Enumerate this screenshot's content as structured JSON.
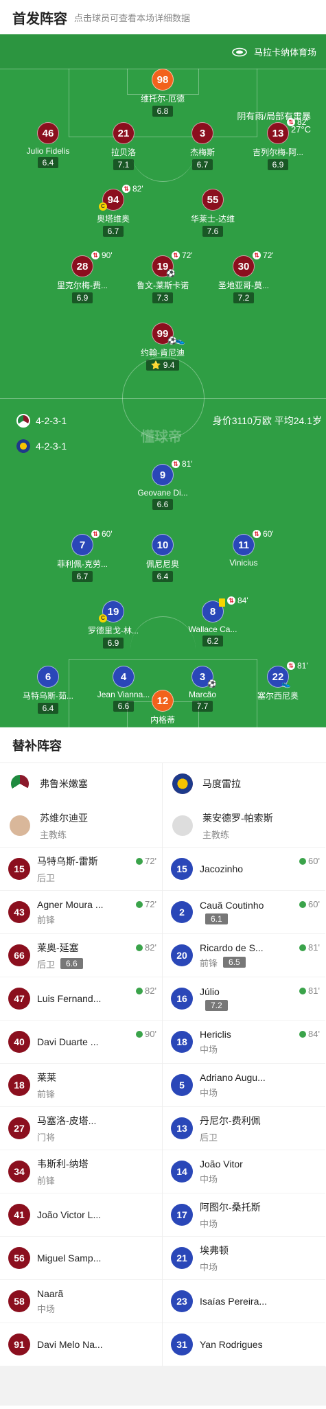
{
  "header": {
    "title": "首发阵容",
    "subtitle": "点击球员可查看本场详细数据"
  },
  "match": {
    "venue": "马拉卡纳体育场",
    "weather": "阴有雨/局部有雷暴",
    "temperature": "27°C",
    "watermark": "懂球帝"
  },
  "home": {
    "formation": "4-2-3-1",
    "value_text": "身价3110万欧 平均24.1岁"
  },
  "away": {
    "formation": "4-2-3-1"
  },
  "home_lineup": [
    {
      "num": "98",
      "name": "维托尔-厄德",
      "rating": "6.8"
    },
    {
      "num": "46",
      "name": "Julio Fidelis",
      "rating": "6.4"
    },
    {
      "num": "21",
      "name": "拉贝洛",
      "rating": "7.1"
    },
    {
      "num": "3",
      "name": "杰梅斯",
      "rating": "6.7"
    },
    {
      "num": "13",
      "name": "吉列尔梅-阿...",
      "rating": "6.9",
      "sub": "82'"
    },
    {
      "num": "94",
      "name": "奥塔维奥",
      "rating": "6.7",
      "sub": "82'"
    },
    {
      "num": "55",
      "name": "华莱士-达维",
      "rating": "7.6"
    },
    {
      "num": "28",
      "name": "里克尔梅-费...",
      "rating": "6.9",
      "sub": "90'"
    },
    {
      "num": "19",
      "name": "鲁文-莱斯卡诺",
      "rating": "7.3",
      "sub": "72'"
    },
    {
      "num": "30",
      "name": "圣地亚哥-莫...",
      "rating": "7.2",
      "sub": "72'"
    },
    {
      "num": "99",
      "name": "约翰-肯尼迪",
      "rating": "9.4"
    }
  ],
  "away_lineup": [
    {
      "num": "9",
      "name": "Geovane Di...",
      "rating": "6.6",
      "sub": "81'"
    },
    {
      "num": "7",
      "name": "菲利佩-克劳...",
      "rating": "6.7",
      "sub": "60'"
    },
    {
      "num": "10",
      "name": "佩尼尼奥",
      "rating": "6.4"
    },
    {
      "num": "11",
      "name": "Vinicius",
      "rating": "",
      "sub": "60'"
    },
    {
      "num": "19",
      "name": "罗德里戈-林...",
      "rating": "6.9"
    },
    {
      "num": "8",
      "name": "Wallace Ca...",
      "rating": "6.2",
      "sub": "84'"
    },
    {
      "num": "6",
      "name": "马特乌斯-茹...",
      "rating": "6.4"
    },
    {
      "num": "4",
      "name": "Jean Vianna...",
      "rating": "6.6"
    },
    {
      "num": "3",
      "name": "Marcão",
      "rating": "7.7"
    },
    {
      "num": "22",
      "name": "塞尔西尼奥",
      "rating": "",
      "sub": "81'"
    },
    {
      "num": "12",
      "name": "内格蒂",
      "rating": ""
    }
  ],
  "subs": {
    "title": "替补阵容",
    "home_team": "弗鲁米嫩塞",
    "away_team": "马度雷拉",
    "home_coach": {
      "name": "苏维尔迪亚",
      "role": "主教练"
    },
    "away_coach": {
      "name": "莱安德罗-帕索斯",
      "role": "主教练"
    },
    "home": [
      {
        "num": "15",
        "name": "马特乌斯-雷斯",
        "pos": "后卫",
        "rating": "",
        "in": "72'"
      },
      {
        "num": "43",
        "name": "Agner Moura ...",
        "pos": "前锋",
        "rating": "",
        "in": "72'"
      },
      {
        "num": "66",
        "name": "莱奥-延塞",
        "pos": "后卫",
        "rating": "6.6",
        "in": "82'"
      },
      {
        "num": "47",
        "name": "Luis Fernand...",
        "pos": "",
        "rating": "",
        "in": "82'"
      },
      {
        "num": "40",
        "name": "Davi Duarte ...",
        "pos": "",
        "rating": "",
        "in": "90'"
      },
      {
        "num": "18",
        "name": "莱莱",
        "pos": "前锋",
        "rating": "",
        "in": ""
      },
      {
        "num": "27",
        "name": "马塞洛-皮塔...",
        "pos": "门将",
        "rating": "",
        "in": ""
      },
      {
        "num": "34",
        "name": "韦斯利-纳塔",
        "pos": "前锋",
        "rating": "",
        "in": ""
      },
      {
        "num": "41",
        "name": "João Victor L...",
        "pos": "",
        "rating": "",
        "in": ""
      },
      {
        "num": "56",
        "name": "Miguel Samp...",
        "pos": "",
        "rating": "",
        "in": ""
      },
      {
        "num": "58",
        "name": "Naarã",
        "pos": "中场",
        "rating": "",
        "in": ""
      },
      {
        "num": "91",
        "name": "Davi Melo Na...",
        "pos": "",
        "rating": "",
        "in": ""
      }
    ],
    "away": [
      {
        "num": "15",
        "name": "Jacozinho",
        "pos": "",
        "rating": "",
        "in": "60'"
      },
      {
        "num": "2",
        "name": "Cauã Coutinho",
        "pos": "",
        "rating": "6.1",
        "in": "60'"
      },
      {
        "num": "20",
        "name": "Ricardo de S...",
        "pos": "前锋",
        "rating": "6.5",
        "in": "81'"
      },
      {
        "num": "16",
        "name": "Júlio",
        "pos": "",
        "rating": "7.2",
        "in": "81'"
      },
      {
        "num": "18",
        "name": "Hericlis",
        "pos": "中场",
        "rating": "",
        "in": "84'"
      },
      {
        "num": "5",
        "name": "Adriano Augu...",
        "pos": "中场",
        "rating": "",
        "in": ""
      },
      {
        "num": "13",
        "name": "丹尼尔-费利佩",
        "pos": "后卫",
        "rating": "",
        "in": ""
      },
      {
        "num": "14",
        "name": "João Vitor",
        "pos": "中场",
        "rating": "",
        "in": ""
      },
      {
        "num": "17",
        "name": "阿图尔-桑托斯",
        "pos": "中场",
        "rating": "",
        "in": ""
      },
      {
        "num": "21",
        "name": "埃弗顿",
        "pos": "中场",
        "rating": "",
        "in": ""
      },
      {
        "num": "23",
        "name": "Isaías Pereira...",
        "pos": "",
        "rating": "",
        "in": ""
      },
      {
        "num": "31",
        "name": "Yan Rodrigues",
        "pos": "",
        "rating": "",
        "in": ""
      }
    ]
  },
  "colors": {
    "pitch": "#2f9e44",
    "home": "#8b0f1e",
    "away": "#2a47b8",
    "keeper": "#f2621c"
  }
}
